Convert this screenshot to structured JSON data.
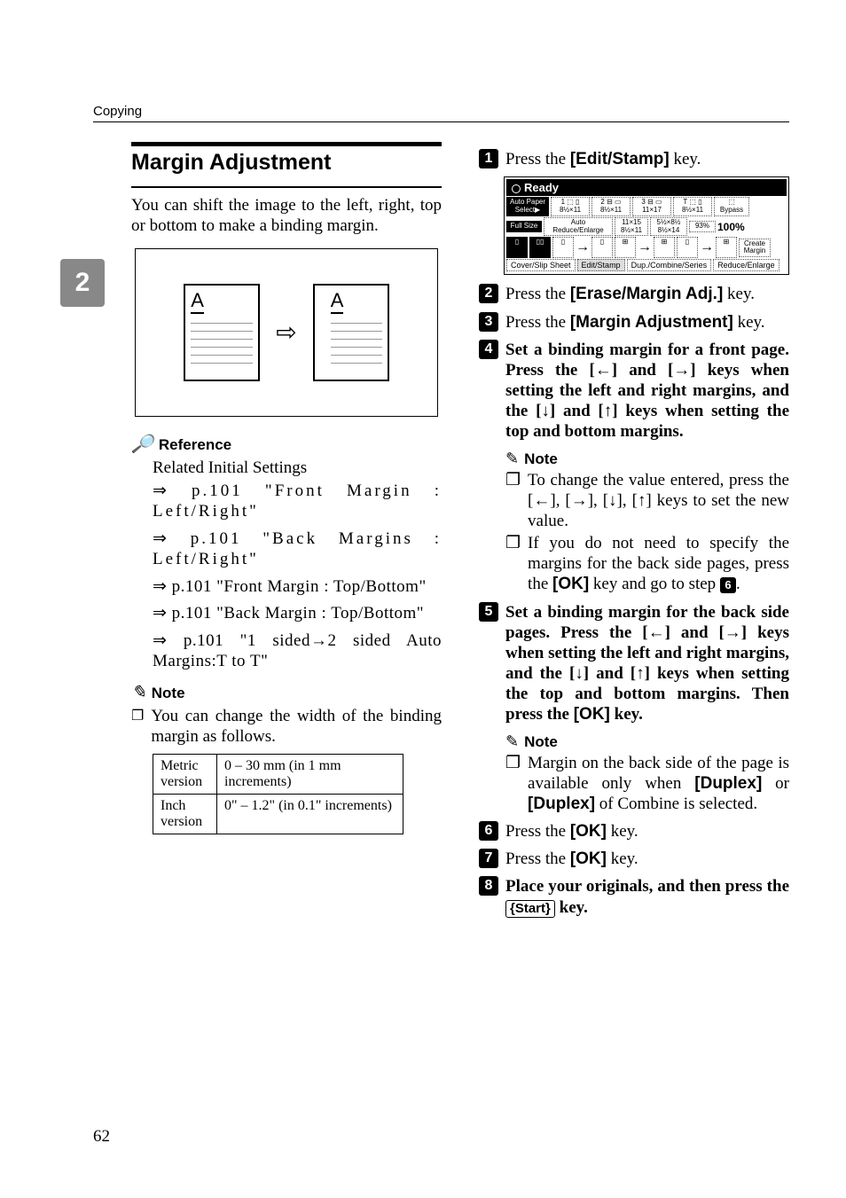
{
  "header": {
    "section": "Copying",
    "chapter_number": "2",
    "page_number": "62"
  },
  "left": {
    "title": "Margin Adjustment",
    "intro": "You can shift the image to the left, right, top or bottom to make a binding margin.",
    "illustration_letter": "A",
    "reference": {
      "label": "Reference",
      "intro": "Related Initial Settings",
      "items": [
        "⇒ p.101 \"Front Margin : Left/Right\"",
        "⇒ p.101 \"Back Margins : Left/Right\"",
        "⇒ p.101 \"Front Margin : Top/Bottom\"",
        "⇒ p.101 \"Back Margin : Top/Bottom\"",
        "⇒ p.101 \"1 sided→2 sided Auto Margins:T to T\""
      ]
    },
    "note": {
      "label": "Note",
      "text": "You can change the width of the binding margin as follows."
    },
    "table": {
      "r1c1": "Metric version",
      "r1c2": "0 – 30 mm (in 1 mm increments)",
      "r2c1": "Inch version",
      "r2c2": "0\" – 1.2\" (in 0.1\" increments)"
    }
  },
  "right": {
    "steps": {
      "s1": {
        "pre": "Press the ",
        "key": "[Edit/Stamp]",
        "post": " key."
      },
      "s2": {
        "pre": "Press the ",
        "key": "[Erase/Margin Adj.]",
        "post": " key."
      },
      "s3": {
        "pre": "Press the ",
        "key": "[Margin Adjustment]",
        "post": " key."
      },
      "s4": "Set a binding margin for a front page. Press the [←] and [→] keys when setting the left and right margins, and the [↓] and [↑] keys when setting the top and bottom margins.",
      "s5": {
        "text": "Set a binding margin for the back side pages. Press the [←] and [→] keys when setting the left and right margins, and the [↓] and [↑] keys when setting the top and bottom margins. Then press the ",
        "key": "[OK]",
        "post": " key."
      },
      "s6": {
        "pre": "Press the ",
        "key": "[OK]",
        "post": " key."
      },
      "s7": {
        "pre": "Press the ",
        "key": "[OK]",
        "post": " key."
      },
      "s8": {
        "pre": "Place your originals, and then press the ",
        "key": "Start",
        "post": " key."
      }
    },
    "note4": {
      "label": "Note",
      "i1": "To change the value entered, press the [←], [→], [↓], [↑] keys to set the new value.",
      "i2a": "If you do not need to specify the margins for the back side pages, press the ",
      "i2key": "[OK]",
      "i2b": " key and go to step ",
      "i2step": "6",
      "i2c": "."
    },
    "note5": {
      "label": "Note",
      "ipre": "Margin on the back side of the page is available only when ",
      "k1": "[Duplex]",
      "mid": " or ",
      "k2": "[Duplex]",
      "ipost": " of Combine is selected."
    },
    "scr": {
      "ready": "Ready",
      "auto_paper": "Auto Paper Select▶",
      "p1": "8½×11",
      "p2": "8½×11",
      "p3": "11×17",
      "p4": "8½×11",
      "bypass": "Bypass",
      "full": "Full Size",
      "are": "Auto Reduce/Enlarge",
      "r1": "11×15 8½×11",
      "r2": "5½×8½ 8½×14",
      "pct": "93%",
      "hund": "100%",
      "create": "Create Margin",
      "t1": "Cover/Slip Sheet",
      "t2": "Edit/Stamp",
      "t3": "Dup./Combine/Series",
      "t4": "Reduce/Enlarge"
    }
  }
}
